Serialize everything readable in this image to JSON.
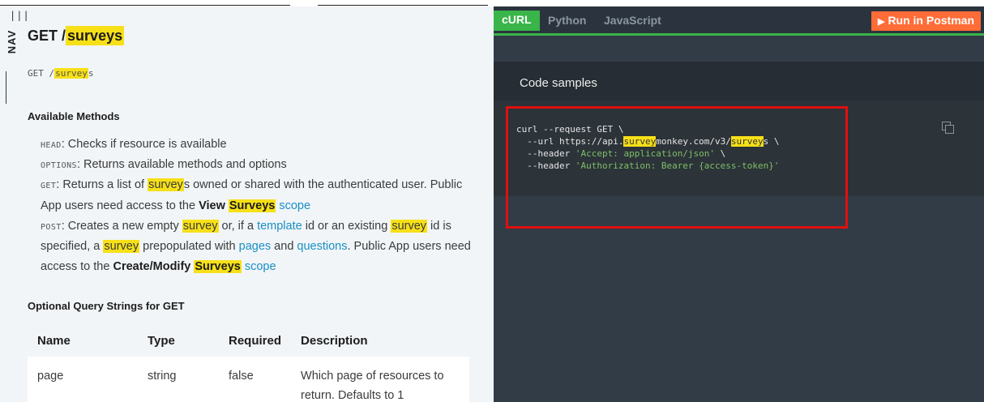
{
  "nav": {
    "bars": "|||",
    "label": "NAV"
  },
  "title": {
    "method": "GET",
    "slash": "/",
    "path": "surveys"
  },
  "path_line": {
    "method": "GET",
    "slash": "/",
    "path": "survey",
    "suffix": "s"
  },
  "available_methods": {
    "heading": "Available Methods",
    "head": {
      "code": "HEAD",
      "text": ": Checks if resource is available"
    },
    "options": {
      "code": "OPTIONS",
      "text": ": Returns available methods and options"
    },
    "get": {
      "code": "GET",
      "t1": ": Returns a list of ",
      "hl1": "survey",
      "t2": "s owned or shared with the authenticated user. Public App users need access to the ",
      "b1": "View ",
      "hl2": "Surveys",
      "t3": " ",
      "link": "scope"
    },
    "post": {
      "code": "POST",
      "t1": ": Creates a new empty ",
      "hl1": "survey",
      "t2": " or, if a ",
      "link1": "template",
      "t3": " id or an existing ",
      "hl2": "survey",
      "t4": " id is specified, a ",
      "hl3": "survey",
      "t5": " prepopulated with ",
      "link2": "pages",
      "t6": " and ",
      "link3": "questions",
      "t7": ". Public App users need access to the ",
      "b1": "Create/Modify ",
      "hl4": "Surveys",
      "t8": " ",
      "link4": "scope"
    }
  },
  "query_strings": {
    "heading": "Optional Query Strings for GET",
    "columns": [
      "Name",
      "Type",
      "Required",
      "Description"
    ],
    "rows": [
      {
        "name": "page",
        "type": "string",
        "required": "false",
        "description": "Which page of resources to return. Defaults to 1"
      }
    ]
  },
  "code_tabs": {
    "curl": "cURL",
    "python": "Python",
    "javascript": "JavaScript",
    "postman": "Run in Postman"
  },
  "code_samples": {
    "heading": "Code samples",
    "line1": "curl --request GET \\",
    "line2_a": "  --url https://api.",
    "line2_hl1": "survey",
    "line2_b": "monkey.com/v3/",
    "line2_hl2": "survey",
    "line2_c": "s \\",
    "line3_a": "  --header ",
    "line3_str": "'Accept: application/json'",
    "line3_b": " \\",
    "line4_a": "  --header ",
    "line4_str": "'Authorization: Bearer {access-token}'"
  },
  "colors": {
    "highlight": "#f7e018",
    "link": "#1a8fc4",
    "tab_active": "#39b54a",
    "postman": "#ff6c37",
    "annotation": "#e01010"
  }
}
